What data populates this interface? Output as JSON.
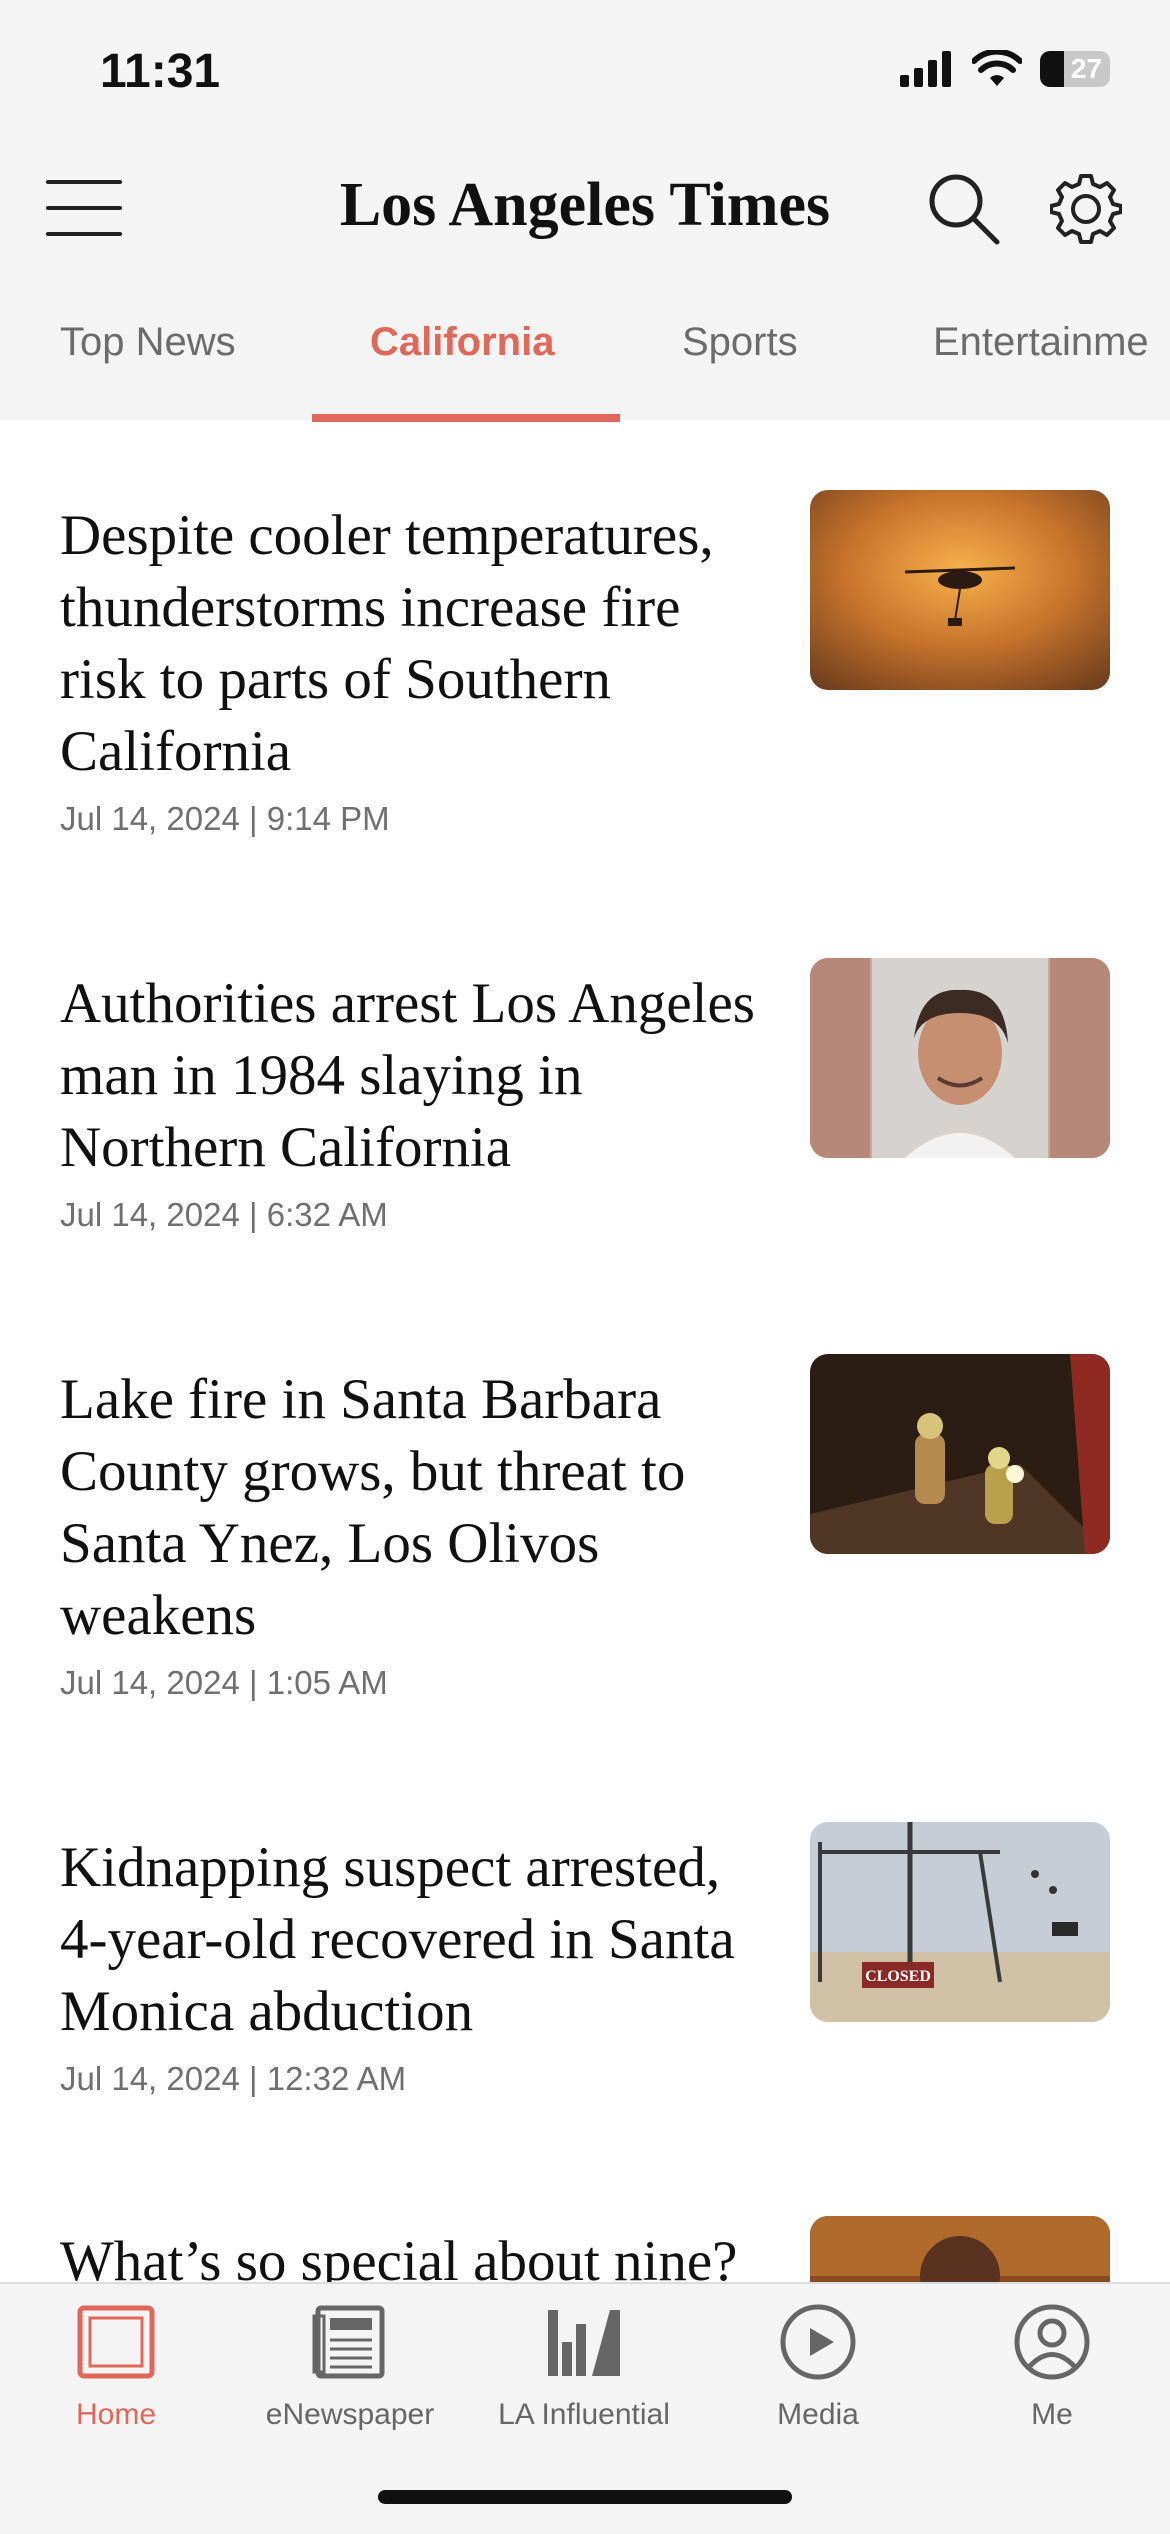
{
  "status": {
    "time": "11:31",
    "battery": "27"
  },
  "header": {
    "logo": "Los Angeles Times"
  },
  "tabs": [
    {
      "label": "Top News",
      "active": false
    },
    {
      "label": "California",
      "active": true
    },
    {
      "label": "Sports",
      "active": false
    },
    {
      "label": "Entertainme",
      "active": false
    }
  ],
  "articles": [
    {
      "headline": "Despite cooler temperatures, thunderstorms increase fire risk to parts of Southern California",
      "date": "Jul 14, 2024 | 9:14 PM",
      "thumbnail": "helicopter at sunset"
    },
    {
      "headline": "Authorities arrest Los Angeles man in 1984 slaying in Northern California",
      "date": "Jul 14, 2024 | 6:32 AM",
      "thumbnail": "booking photo"
    },
    {
      "headline": "Lake fire in Santa Barbara County grows, but threat to Santa Ynez, Los Olivos weakens",
      "date": "Jul 14, 2024 | 1:05 AM",
      "thumbnail": "firefighters at night"
    },
    {
      "headline": "Kidnapping suspect arrested, 4-year-old recovered in Santa Monica abduction",
      "date": "Jul 14, 2024 | 12:32 AM",
      "thumbnail": "closed beach playground",
      "thumb_sign": "CLOSED"
    },
    {
      "headline": "What’s so special about nine?",
      "date": "",
      "thumbnail": "portrait"
    }
  ],
  "tabbar": [
    {
      "label": "Home",
      "icon": "home-icon",
      "active": true
    },
    {
      "label": "eNewspaper",
      "icon": "newspaper-icon",
      "active": false
    },
    {
      "label": "LA Influential",
      "icon": "influential-icon",
      "active": false
    },
    {
      "label": "Media",
      "icon": "play-icon",
      "active": false
    },
    {
      "label": "Me",
      "icon": "profile-icon",
      "active": false
    }
  ],
  "colors": {
    "accent": "#e0685a",
    "text": "#111111",
    "muted": "#707070",
    "bar_bg": "#f4f4f4"
  }
}
